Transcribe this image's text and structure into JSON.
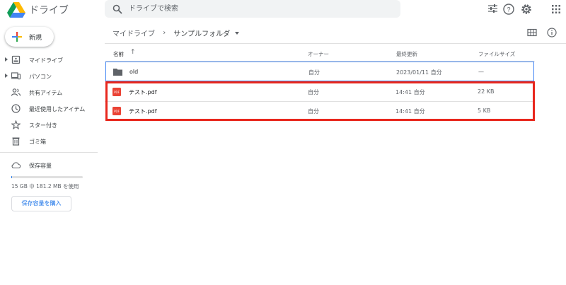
{
  "app": {
    "title": "ドライブ",
    "logo": "google-drive-logo"
  },
  "search": {
    "placeholder": "ドライブで検索",
    "icon": "search-icon",
    "options_icon": "tune-icon"
  },
  "header_icons": [
    "help-icon",
    "settings-gear-icon",
    "apps-grid-icon"
  ],
  "sidebar": {
    "new_label": "新規",
    "items": [
      {
        "label": "マイドライブ",
        "icon": "my-drive-icon",
        "expandable": true
      },
      {
        "label": "パソコン",
        "icon": "computers-icon",
        "expandable": true
      },
      {
        "label": "共有アイテム",
        "icon": "shared-people-icon",
        "expandable": false
      },
      {
        "label": "最近使用したアイテム",
        "icon": "clock-icon",
        "expandable": false
      },
      {
        "label": "スター付き",
        "icon": "star-icon",
        "expandable": false
      },
      {
        "label": "ゴミ箱",
        "icon": "trash-icon",
        "expandable": false
      }
    ],
    "storage": {
      "label": "保存容量",
      "icon": "cloud-icon",
      "usage_text": "15 GB 中 181.2 MB を使用",
      "used_fraction": 0.012,
      "buy_label": "保存容量を購入"
    }
  },
  "breadcrumb": {
    "root": "マイドライブ",
    "separator": "›",
    "current": "サンプルフォルダ"
  },
  "view_icons": [
    "grid-view-icon",
    "info-icon"
  ],
  "table": {
    "columns": {
      "name": "名前",
      "sort_indicator": "↑",
      "owner": "オーナー",
      "modified": "最終更新",
      "size": "ファイルサイズ"
    },
    "rows": [
      {
        "type": "folder",
        "name": "old",
        "owner": "自分",
        "modified": "2023/01/11 自分",
        "size": "—"
      },
      {
        "type": "pdf",
        "name": "テスト.pdf",
        "owner": "自分",
        "modified": "14:41 自分",
        "size": "22 KB"
      },
      {
        "type": "pdf",
        "name": "テスト.pdf",
        "owner": "自分",
        "modified": "14:41 自分",
        "size": "5 KB"
      }
    ]
  },
  "colors": {
    "accent": "#1a73e8",
    "highlight": "#e8271d",
    "pdf_red": "#ea4335",
    "folder_gray": "#5f6368"
  }
}
